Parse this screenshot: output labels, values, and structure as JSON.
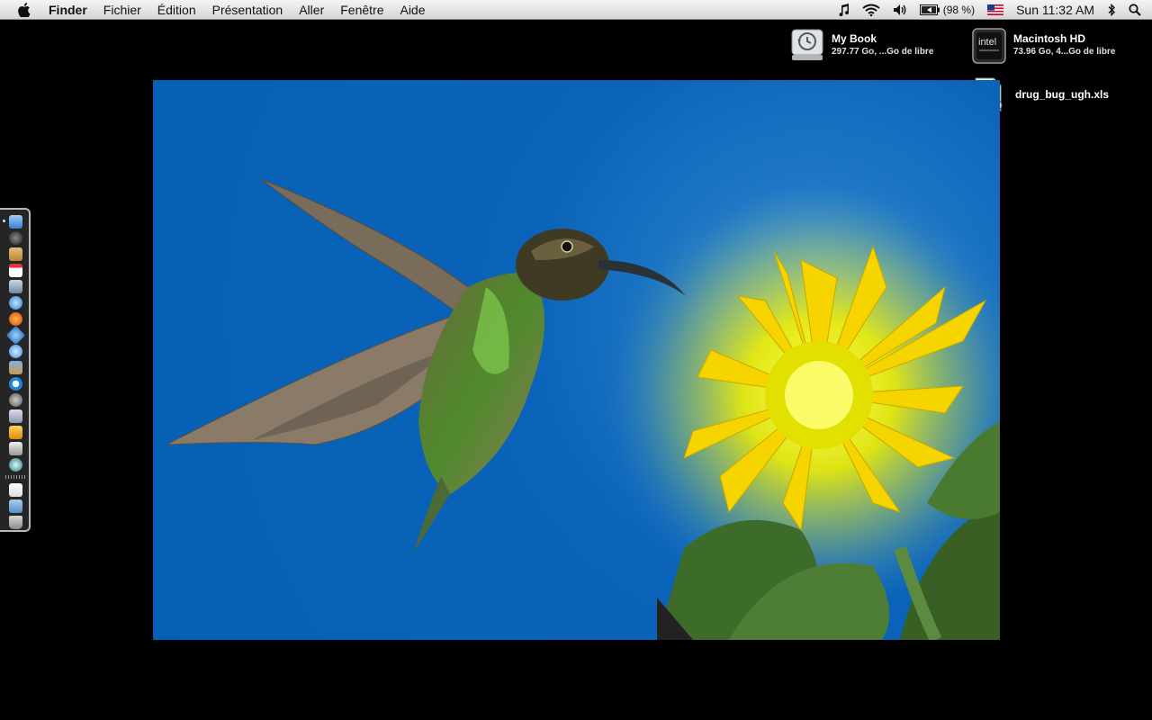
{
  "menubar": {
    "app_name": "Finder",
    "menus": [
      "Fichier",
      "Édition",
      "Présentation",
      "Aller",
      "Fenêtre",
      "Aide"
    ],
    "battery_text": "(98 %)",
    "clock": "Sun 11:32 AM"
  },
  "desktop_icons": [
    {
      "name": "My Book",
      "sub": "297.77 Go, ...Go de libre"
    },
    {
      "name": "Macintosh HD",
      "sub": "73.96 Go, 4...Go de libre"
    },
    {
      "name": "drug_bug_ugh.xls",
      "sub": ""
    }
  ],
  "intel_logo": "intel",
  "colors": {
    "desktop_bg": "#000000",
    "wallpaper_sky": "#0560b4",
    "sunflower": "#ffe600",
    "menubar": "#e8e8e8"
  },
  "dock": {
    "icons": [
      "finder-icon",
      "dashboard-icon",
      "address-book-icon",
      "ical-icon",
      "preview-icon",
      "safari-icon",
      "firefox-icon",
      "network-icon",
      "itunes-icon",
      "iphoto-icon",
      "quicktime-icon",
      "system-prefs-icon",
      "photo-booth-icon",
      "money-icon",
      "screenshot-icon",
      "time-machine-icon",
      "documents-icon",
      "applications-folder-icon",
      "trash-icon"
    ]
  }
}
